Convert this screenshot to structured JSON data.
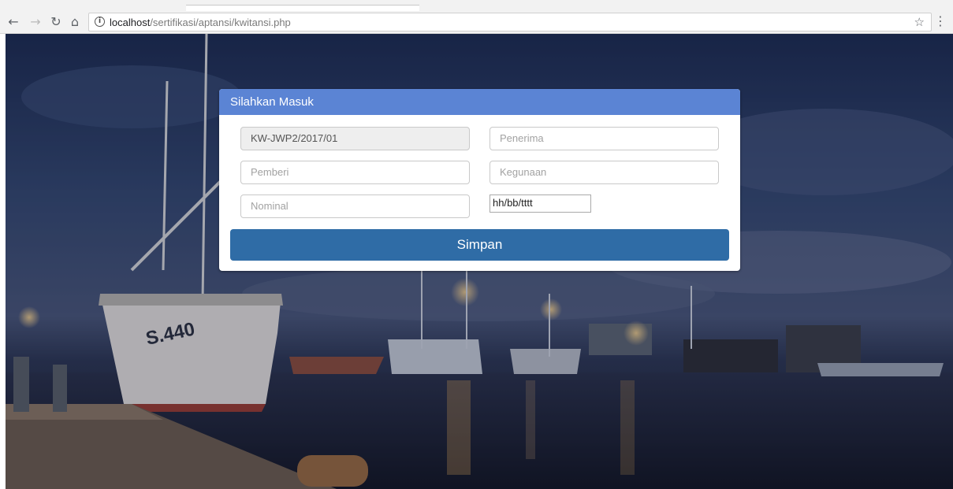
{
  "browser": {
    "url_host": "localhost",
    "url_path": "/sertifikasi/aptansi/kwitansi.php",
    "back_icon": "arrow-left-icon",
    "forward_icon": "arrow-right-icon",
    "reload_icon": "reload-icon",
    "home_icon": "home-icon",
    "info_icon": "info-icon",
    "bookmark_icon": "star-icon",
    "menu_icon": "more-vertical-icon"
  },
  "panel": {
    "heading": "Silahkan Masuk",
    "heading_color": "#5b84d4",
    "fields": {
      "nomor": {
        "value": "KW-JWP2/2017/01",
        "readonly": true
      },
      "penerima": {
        "placeholder": "Penerima"
      },
      "pemberi": {
        "placeholder": "Pemberi"
      },
      "kegunaan": {
        "placeholder": "Kegunaan"
      },
      "nominal": {
        "placeholder": "Nominal"
      },
      "tanggal": {
        "placeholder": "hh/bb/tttt"
      }
    },
    "save_label": "Simpan",
    "save_color": "#2f6ca6"
  },
  "background": {
    "description_icon": "harbor-night-photo",
    "boat_hull_text": "S.440"
  }
}
